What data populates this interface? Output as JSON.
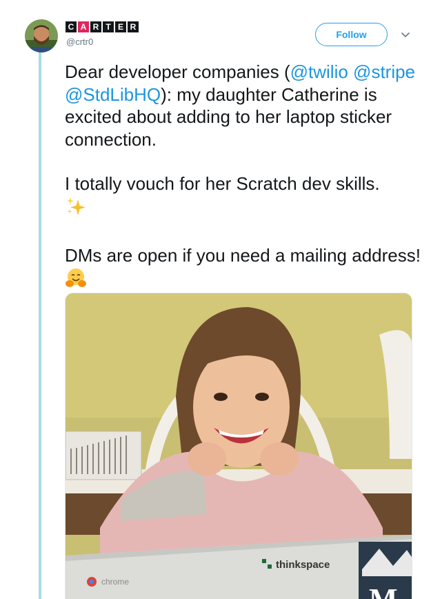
{
  "user": {
    "display_letters": [
      "C",
      "A",
      "R",
      "T",
      "E",
      "R"
    ],
    "handle": "@crtr0"
  },
  "follow_button": {
    "label": "Follow"
  },
  "tweet": {
    "p1": {
      "pre": "Dear developer companies (",
      "mention1": "@twilio",
      "space1": " ",
      "mention2": "@stripe",
      "space2": " ",
      "mention3": "@StdLibHQ",
      "post": "): my daughter Catherine is excited about adding to her laptop sticker connection."
    },
    "p2": "I totally vouch for her Scratch dev skills.",
    "p3": "DMs are open if you need a mailing address!"
  },
  "photo_labels": {
    "chrome": "chrome",
    "thinkspace": "thinkspace",
    "sticker": "M"
  },
  "colors": {
    "link": "#1b95e0",
    "follow": "#1da1f2",
    "thread_line": "#a7dce8"
  },
  "icons": [
    "chevron-down-icon",
    "sparkles-icon",
    "hugging-face-icon"
  ]
}
